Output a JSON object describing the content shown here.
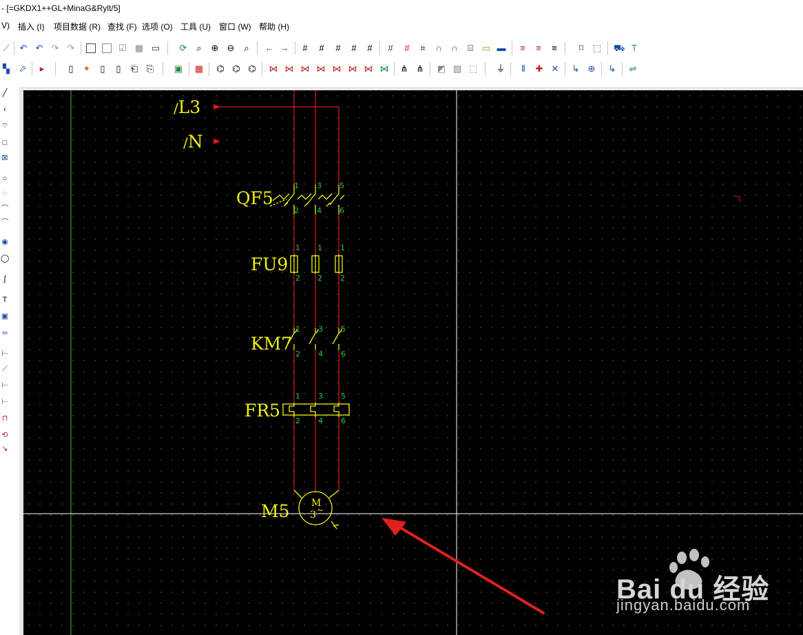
{
  "window": {
    "title": "- [=GKDX1++GL+MinaG&Rylt/5]"
  },
  "menu": [
    {
      "label": "V)"
    },
    {
      "label": "插入 (I)"
    },
    {
      "label": "项目数据 (R)"
    },
    {
      "label": "查找 (F)"
    },
    {
      "label": "选项 (O)"
    },
    {
      "label": "工具 (U)"
    },
    {
      "label": "窗口 (W)"
    },
    {
      "label": "帮助 (H)"
    }
  ],
  "schematic": {
    "potentials": [
      {
        "prefix": "/",
        "label": "L3"
      },
      {
        "prefix": "/",
        "label": "N"
      }
    ],
    "devices": {
      "qf": {
        "tag": "QF5",
        "pins_top": [
          "1",
          "3",
          "5"
        ],
        "pins_bottom": [
          "2",
          "4",
          "6"
        ]
      },
      "fu": {
        "tag": "FU9",
        "pins_top": [
          "1",
          "1",
          "1"
        ],
        "pins_bottom": [
          "2",
          "2",
          "2"
        ]
      },
      "km": {
        "tag": "KM7",
        "pins_top": [
          "1",
          "3",
          "5"
        ],
        "pins_bottom": [
          "2",
          "4",
          "6"
        ]
      },
      "fr": {
        "tag": "FR5",
        "pins_top": [
          "1",
          "3",
          "5"
        ],
        "pins_bottom": [
          "2",
          "4",
          "6"
        ]
      },
      "motor": {
        "tag": "M5",
        "symbol_top": "M",
        "symbol_bottom": "3",
        "symbol_phase": "~"
      }
    },
    "colors": {
      "wire": "#e01818",
      "device": "#f2f20a",
      "pin": "#22cc33",
      "crosshair": "#ffffff",
      "guide": "#22cc33",
      "arrow": "#e02020"
    }
  },
  "watermark": {
    "brand": "Bai du 经验",
    "url": "jingyan.baidu.com"
  }
}
